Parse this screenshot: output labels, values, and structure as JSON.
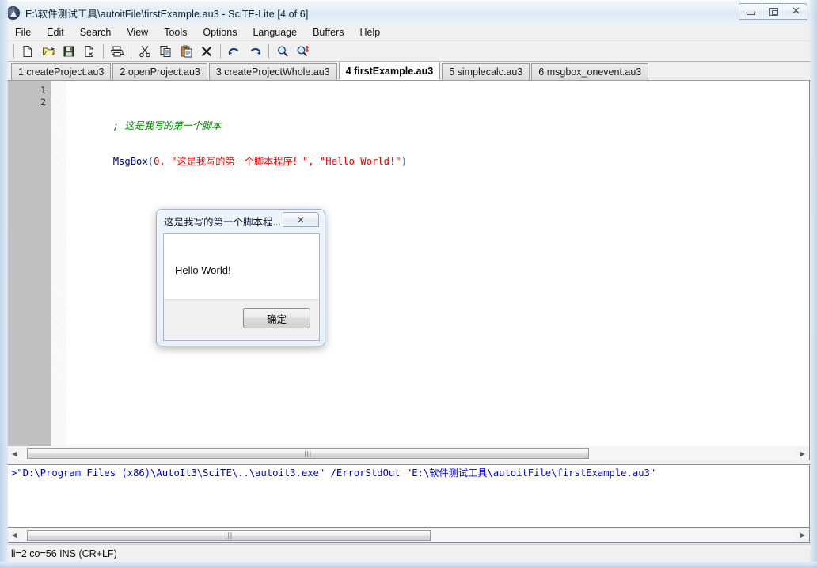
{
  "window": {
    "title": "E:\\软件测试工具\\autoitFile\\firstExample.au3 - SciTE-Lite [4 of 6]",
    "app_icon": "autoit-icon",
    "controls": {
      "minimize": "minimize-icon",
      "maximize": "maximize-icon",
      "close": "✕"
    }
  },
  "menubar": {
    "items": [
      {
        "label": "File"
      },
      {
        "label": "Edit"
      },
      {
        "label": "Search"
      },
      {
        "label": "View"
      },
      {
        "label": "Tools"
      },
      {
        "label": "Options"
      },
      {
        "label": "Language"
      },
      {
        "label": "Buffers"
      },
      {
        "label": "Help"
      }
    ]
  },
  "toolbar": {
    "buttons": [
      {
        "name": "new-file-icon",
        "title": "New"
      },
      {
        "name": "open-file-icon",
        "title": "Open"
      },
      {
        "name": "save-file-icon",
        "title": "Save"
      },
      {
        "name": "close-file-icon",
        "title": "Close"
      },
      {
        "name": "print-icon",
        "title": "Print"
      },
      {
        "name": "cut-icon",
        "title": "Cut"
      },
      {
        "name": "copy-icon",
        "title": "Copy"
      },
      {
        "name": "paste-icon",
        "title": "Paste"
      },
      {
        "name": "delete-icon",
        "title": "Delete"
      },
      {
        "name": "undo-icon",
        "title": "Undo"
      },
      {
        "name": "redo-icon",
        "title": "Redo"
      },
      {
        "name": "find-icon",
        "title": "Find"
      },
      {
        "name": "replace-icon",
        "title": "Replace"
      }
    ]
  },
  "tabs": [
    {
      "label": "1 createProject.au3",
      "active": false
    },
    {
      "label": "2 openProject.au3",
      "active": false
    },
    {
      "label": "3 createProjectWhole.au3",
      "active": false
    },
    {
      "label": "4 firstExample.au3",
      "active": true
    },
    {
      "label": "5 simplecalc.au3",
      "active": false
    },
    {
      "label": "6 msgbox_onevent.au3",
      "active": false
    }
  ],
  "editor": {
    "line_numbers": [
      "1",
      "2"
    ],
    "lines": [
      {
        "tokens": [
          {
            "text": "; 这是我写的第一个脚本",
            "type": "comment"
          }
        ]
      },
      {
        "tokens": [
          {
            "text": "MsgBox",
            "type": "func"
          },
          {
            "text": "(",
            "type": "paren"
          },
          {
            "text": "0",
            "type": "num"
          },
          {
            "text": ", ",
            "type": "comma"
          },
          {
            "text": "\"这是我写的第一个脚本程序！\"",
            "type": "str"
          },
          {
            "text": ", ",
            "type": "comma"
          },
          {
            "text": "\"Hello World!\"",
            "type": "str"
          },
          {
            "text": ")",
            "type": "paren"
          }
        ]
      }
    ],
    "colors": {
      "comment": "#008000",
      "function": "#00008b",
      "number": "#cc0000",
      "string": "#ee0000",
      "paren": "#4169b8",
      "linenumber_bg": "#c0c0c0"
    }
  },
  "output": {
    "text": ">\"D:\\Program Files (x86)\\AutoIt3\\SciTE\\..\\autoit3.exe\" /ErrorStdOut \"E:\\软件测试工具\\autoitFile\\firstExample.au3\"",
    "color": "#0000cd"
  },
  "scrollbars": {
    "left_arrow": "◀",
    "right_arrow": "▶",
    "grip": "|||"
  },
  "statusbar": {
    "text": "li=2 co=56 INS (CR+LF)"
  },
  "msgbox": {
    "title": "这是我写的第一个脚本程...",
    "close_glyph": "✕",
    "message": "Hello World!",
    "ok_label": "确定"
  }
}
